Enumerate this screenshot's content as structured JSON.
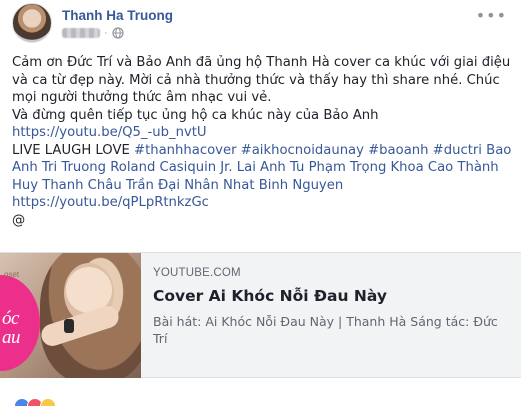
{
  "post": {
    "author": "Thanh Ha Truong",
    "body_lines": [
      "Cảm ơn Đức Trí và Bảo Anh đã ủng hộ Thanh Hà cover ca khúc với giai điệu và ca từ đẹp này. Mời cả nhà thưởng thức và thấy hay thì share nhé. Chúc mọi người thưởng thức âm nhạc vui vẻ.",
      "Và đừng quên tiếp tục ủng hộ ca khúc này của Bảo Anh "
    ],
    "link1": "https://youtu.be/Q5_-ub_nvtU",
    "tagline": "LIVE LAUGH LOVE ",
    "hashtags": "#thanhhacover #aikhocnoidaunay #baoanh #ductri",
    "mentions": " Bao Anh Tri Truong Roland Casiquin Jr. Lai Anh Tu Phạm Trọng Khoa Cao Thành Huy Thanh Châu Trần Đại Nhân Nhat Binh Nguyen",
    "link2": "https://youtu.be/qPLpRtnkzGc",
    "at_symbol": "@"
  },
  "preview": {
    "domain": "YOUTUBE.COM",
    "title": "Cover Ai Khóc Nỗi Đau Này",
    "description": "Bài hát: Ai Khóc Nỗi Đau Này | Thanh Hà Sáng tác: Đức Trí",
    "thumb_text": "óc\nau",
    "thumb_small": "oset"
  },
  "icons": {
    "more": "more-options-icon",
    "privacy": "globe-icon"
  },
  "colors": {
    "link": "#385898",
    "text": "#1d2129",
    "muted": "#606770",
    "preview_bg": "#f2f3f5",
    "thumb_accent": "#ec2f8b"
  }
}
